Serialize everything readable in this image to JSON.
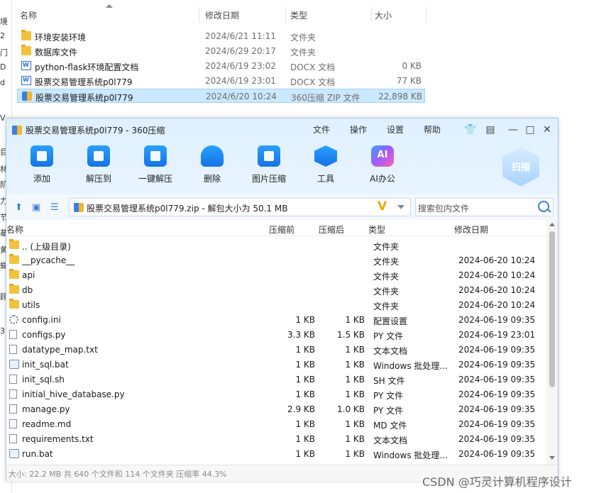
{
  "explorer": {
    "left_strip_chars": [
      "境",
      "2",
      "门",
      "D",
      "d",
      "V",
      "目",
      "林",
      "阶",
      "力",
      "节",
      "基",
      "黄",
      "蝴",
      "3",
      "顾"
    ],
    "columns": [
      "名称",
      "修改日期",
      "类型",
      "大小"
    ],
    "rows": [
      {
        "name": "环境安装环境",
        "date": "2024/6/21 11:11",
        "type": "文件夹",
        "size": "",
        "icon": "folder-icon"
      },
      {
        "name": "数据库文件",
        "date": "2024/6/29 20:17",
        "type": "文件夹",
        "size": "",
        "icon": "folder-icon"
      },
      {
        "name": "python-flask环境配置文档",
        "date": "2024/6/19 23:02",
        "type": "DOCX 文档",
        "size": "0 KB",
        "icon": "docx-icon"
      },
      {
        "name": "股票交易管理系统p0l779",
        "date": "2024/6/19 23:01",
        "type": "DOCX 文档",
        "size": "77 KB",
        "icon": "docx-icon"
      },
      {
        "name": "股票交易管理系统p0l779",
        "date": "2024/6/20 10:24",
        "type": "360压缩 ZIP 文件",
        "size": "22,898 KB",
        "icon": "zip-icon"
      }
    ]
  },
  "zip_window": {
    "title": "股票交易管理系统p0l779 - 360压缩",
    "menus": [
      "文件",
      "操作",
      "设置",
      "帮助"
    ],
    "toolbar": [
      {
        "label": "添加",
        "icon": "add-icon"
      },
      {
        "label": "解压到",
        "icon": "extract-to-icon"
      },
      {
        "label": "一键解压",
        "icon": "one-click-extract-icon"
      },
      {
        "label": "删除",
        "icon": "delete-icon"
      },
      {
        "label": "图片压缩",
        "icon": "image-compress-icon"
      },
      {
        "label": "工具",
        "icon": "tools-icon"
      },
      {
        "label": "AI办公",
        "icon": "ai-office-icon"
      }
    ],
    "scan_label": "扫描",
    "address": "股票交易管理系统p0l779.zip - 解包大小为 50.1 MB",
    "search_placeholder": "搜索包内文件",
    "columns": [
      "名称",
      "压缩前",
      "压缩后",
      "类型",
      "修改日期"
    ],
    "files": [
      {
        "name": ".. (上级目录)",
        "before": "",
        "after": "",
        "type": "文件夹",
        "date": "",
        "icon": "folder-icon"
      },
      {
        "name": "__pycache__",
        "before": "",
        "after": "",
        "type": "文件夹",
        "date": "2024-06-20 10:24",
        "icon": "folder-icon"
      },
      {
        "name": "api",
        "before": "",
        "after": "",
        "type": "文件夹",
        "date": "2024-06-20 10:24",
        "icon": "folder-icon"
      },
      {
        "name": "db",
        "before": "",
        "after": "",
        "type": "文件夹",
        "date": "2024-06-20 10:24",
        "icon": "folder-icon"
      },
      {
        "name": "utils",
        "before": "",
        "after": "",
        "type": "文件夹",
        "date": "2024-06-20 10:24",
        "icon": "folder-icon"
      },
      {
        "name": "config.ini",
        "before": "1 KB",
        "after": "1 KB",
        "type": "配置设置",
        "date": "2024-06-19 09:35",
        "icon": "config-file-icon"
      },
      {
        "name": "configs.py",
        "before": "3.3 KB",
        "after": "1.5 KB",
        "type": "PY 文件",
        "date": "2024-06-19 23:01",
        "icon": "file-icon"
      },
      {
        "name": "datatype_map.txt",
        "before": "1 KB",
        "after": "1 KB",
        "type": "文本文档",
        "date": "2024-06-19 09:35",
        "icon": "file-icon"
      },
      {
        "name": "init_sql.bat",
        "before": "1 KB",
        "after": "1 KB",
        "type": "Windows 批处理...",
        "date": "2024-06-19 09:35",
        "icon": "batch-file-icon"
      },
      {
        "name": "init_sql.sh",
        "before": "1 KB",
        "after": "1 KB",
        "type": "SH 文件",
        "date": "2024-06-19 09:35",
        "icon": "file-icon"
      },
      {
        "name": "initial_hive_database.py",
        "before": "1 KB",
        "after": "1 KB",
        "type": "PY 文件",
        "date": "2024-06-19 09:35",
        "icon": "file-icon"
      },
      {
        "name": "manage.py",
        "before": "2.9 KB",
        "after": "1.0 KB",
        "type": "PY 文件",
        "date": "2024-06-19 09:35",
        "icon": "file-icon"
      },
      {
        "name": "readme.md",
        "before": "1 KB",
        "after": "1 KB",
        "type": "MD 文件",
        "date": "2024-06-19 09:35",
        "icon": "file-icon"
      },
      {
        "name": "requirements.txt",
        "before": "1 KB",
        "after": "1 KB",
        "type": "文本文档",
        "date": "2024-06-19 09:35",
        "icon": "file-icon"
      },
      {
        "name": "run.bat",
        "before": "1 KB",
        "after": "1 KB",
        "type": "Windows 批处理...",
        "date": "2024-06-19 09:35",
        "icon": "batch-file-icon"
      }
    ],
    "status": "大小: 22.2 MB 共 640 个文件和 114 个文件夹 压缩率 44.3%"
  },
  "watermark": "CSDN @巧灵计算机程序设计"
}
